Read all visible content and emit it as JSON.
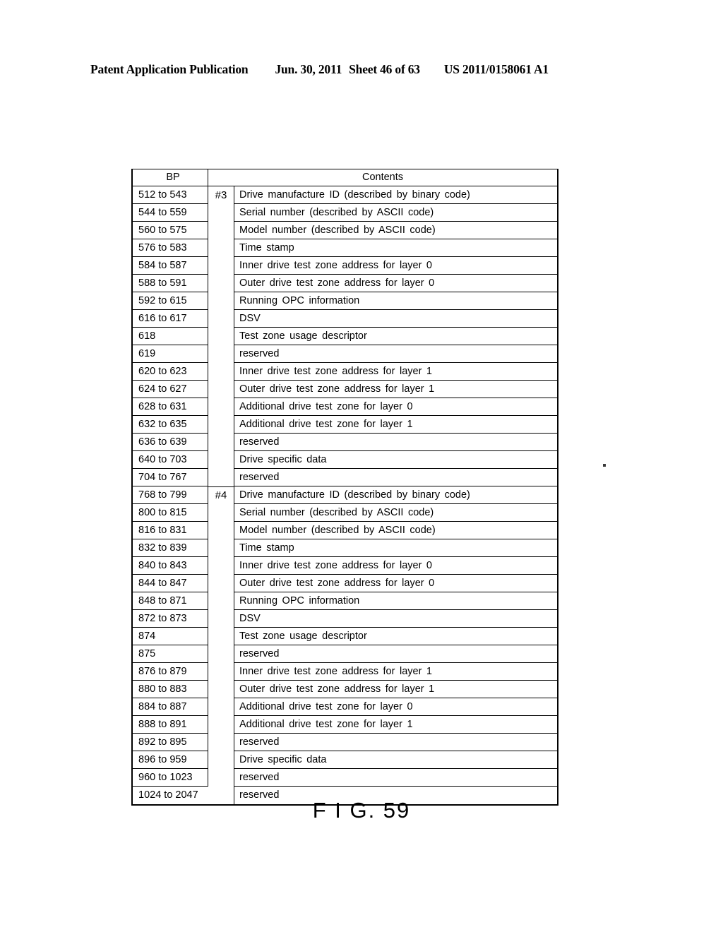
{
  "header": {
    "publication": "Patent Application Publication",
    "date": "Jun. 30, 2011",
    "sheet": "Sheet 46 of 63",
    "patent_number": "US 2011/0158061 A1"
  },
  "figure": {
    "caption": "F I G. 59"
  },
  "table": {
    "columns": {
      "bp": "BP",
      "contents": "Contents"
    },
    "block_markers": {
      "block3": "#3",
      "block4": "#4"
    },
    "rows": [
      {
        "bp": "512 to 543",
        "contents": "Drive manufacture ID (described by binary code)"
      },
      {
        "bp": "544 to 559",
        "contents": "Serial number (described by ASCII code)"
      },
      {
        "bp": "560 to 575",
        "contents": "Model number (described by ASCII code)"
      },
      {
        "bp": "576 to 583",
        "contents": "Time stamp"
      },
      {
        "bp": "584 to 587",
        "contents": "Inner drive test zone address for layer 0"
      },
      {
        "bp": "588 to 591",
        "contents": "Outer drive test zone address for layer 0"
      },
      {
        "bp": "592 to 615",
        "contents": "Running OPC information"
      },
      {
        "bp": "616 to 617",
        "contents": "DSV"
      },
      {
        "bp": "618",
        "contents": "Test zone usage descriptor"
      },
      {
        "bp": "619",
        "contents": "reserved"
      },
      {
        "bp": "620 to 623",
        "contents": "Inner drive test zone address for layer 1"
      },
      {
        "bp": "624 to 627",
        "contents": "Outer drive test zone address for layer 1"
      },
      {
        "bp": "628 to 631",
        "contents": "Additional drive test zone for layer 0"
      },
      {
        "bp": "632 to 635",
        "contents": "Additional drive test zone for layer 1"
      },
      {
        "bp": "636 to 639",
        "contents": "reserved"
      },
      {
        "bp": "640 to 703",
        "contents": "Drive specific data"
      },
      {
        "bp": "704 to 767",
        "contents": "reserved"
      },
      {
        "bp": "768 to 799",
        "contents": "Drive manufacture ID (described by binary code)"
      },
      {
        "bp": "800 to 815",
        "contents": "Serial number (described by ASCII code)"
      },
      {
        "bp": "816 to 831",
        "contents": "Model number (described by ASCII code)"
      },
      {
        "bp": "832 to 839",
        "contents": "Time stamp"
      },
      {
        "bp": "840 to 843",
        "contents": "Inner drive test zone address for layer 0"
      },
      {
        "bp": "844 to 847",
        "contents": "Outer drive test zone address for layer 0"
      },
      {
        "bp": "848 to 871",
        "contents": "Running OPC information"
      },
      {
        "bp": "872 to 873",
        "contents": "DSV"
      },
      {
        "bp": "874",
        "contents": "Test zone usage descriptor"
      },
      {
        "bp": "875",
        "contents": "reserved"
      },
      {
        "bp": "876 to 879",
        "contents": "Inner drive test zone address for layer 1"
      },
      {
        "bp": "880 to 883",
        "contents": "Outer drive test zone address for layer 1"
      },
      {
        "bp": "884 to 887",
        "contents": "Additional drive test zone for layer 0"
      },
      {
        "bp": "888 to 891",
        "contents": "Additional drive test zone for layer 1"
      },
      {
        "bp": "892 to 895",
        "contents": "reserved"
      },
      {
        "bp": "896 to 959",
        "contents": "Drive specific data"
      },
      {
        "bp": "960 to 1023",
        "contents": "reserved"
      },
      {
        "bp": "1024 to 2047",
        "contents": "reserved"
      }
    ]
  }
}
